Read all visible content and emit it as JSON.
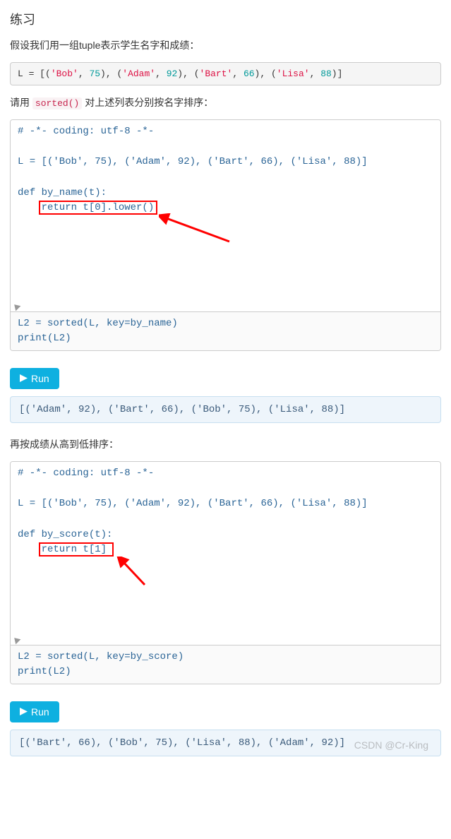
{
  "title": "练习",
  "p1": "假设我们用一组tuple表示学生名字和成绩：",
  "code_small_html": "L = [(<span class='str'>'Bob'</span>, <span class='num'>75</span>), (<span class='str'>'Adam'</span>, <span class='num'>92</span>), (<span class='str'>'Bart'</span>, <span class='num'>66</span>), (<span class='str'>'Lisa'</span>, <span class='num'>88</span>)]",
  "p2_a": "请用 ",
  "p2_code": "sorted()",
  "p2_b": " 对上述列表分别按名字排序：",
  "editor1_top": "# -*- coding: utf-8 -*-\n\nL = [('Bob', 75), ('Adam', 92), ('Bart', 66), ('Lisa', 88)]\n\ndef by_name(t):\n    return t[0].lower()",
  "editor1_bot": "L2 = sorted(L, key=by_name)\nprint(L2)",
  "run_label": "Run",
  "output1": "[('Adam', 92), ('Bart', 66), ('Bob', 75), ('Lisa', 88)]",
  "p3": "再按成绩从高到低排序：",
  "editor2_top": "# -*- coding: utf-8 -*-\n\nL = [('Bob', 75), ('Adam', 92), ('Bart', 66), ('Lisa', 88)]\n\ndef by_score(t):\n    return t[1]",
  "editor2_bot": "L2 = sorted(L, key=by_score)\nprint(L2)",
  "output2": "[('Bart', 66), ('Bob', 75), ('Lisa', 88), ('Adam', 92)]",
  "watermark": "CSDN @Cr-King"
}
